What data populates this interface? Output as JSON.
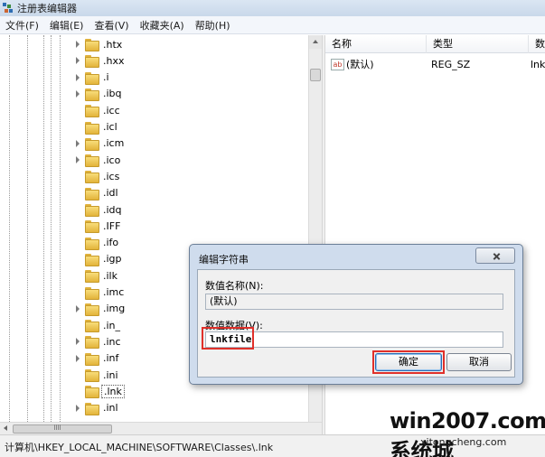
{
  "window": {
    "title": "注册表编辑器"
  },
  "menu": [
    "文件(F)",
    "编辑(E)",
    "查看(V)",
    "收藏夹(A)",
    "帮助(H)"
  ],
  "tree": {
    "items": [
      ".htx",
      ".hxx",
      ".i",
      ".ibq",
      ".icc",
      ".icl",
      ".icm",
      ".ico",
      ".ics",
      ".idl",
      ".idq",
      ".IFF",
      ".ifo",
      ".igp",
      ".ilk",
      ".imc",
      ".img",
      ".in_",
      ".inc",
      ".inf",
      ".ini",
      ".lnk",
      ".inl"
    ],
    "selected": ".lnk",
    "collapsed_rows": [
      ".icc",
      ".icl",
      ".ics",
      ".idl",
      ".idq",
      ".IFF",
      ".ifo",
      ".igp",
      ".ilk",
      ".imc",
      ".in_",
      ".ini",
      ".lnk"
    ]
  },
  "list": {
    "columns": [
      "名称",
      "类型",
      "数"
    ],
    "rows": [
      {
        "icon": "ab",
        "name": "(默认)",
        "type": "REG_SZ",
        "data": "lnk"
      }
    ]
  },
  "status": {
    "path": "计算机\\HKEY_LOCAL_MACHINE\\SOFTWARE\\Classes\\.lnk"
  },
  "watermark": {
    "main": "win2007.com系统城",
    "sub": "xitongcheng.com"
  },
  "dialog": {
    "title": "编辑字符串",
    "name_label": "数值名称(N):",
    "name_value": "(默认)",
    "data_label": "数值数据(V):",
    "data_value": "lnkfile",
    "ok_label": "确定",
    "cancel_label": "取消"
  },
  "colors": {
    "highlight_outline": "#e0302a",
    "folder": "#e3b43a"
  }
}
